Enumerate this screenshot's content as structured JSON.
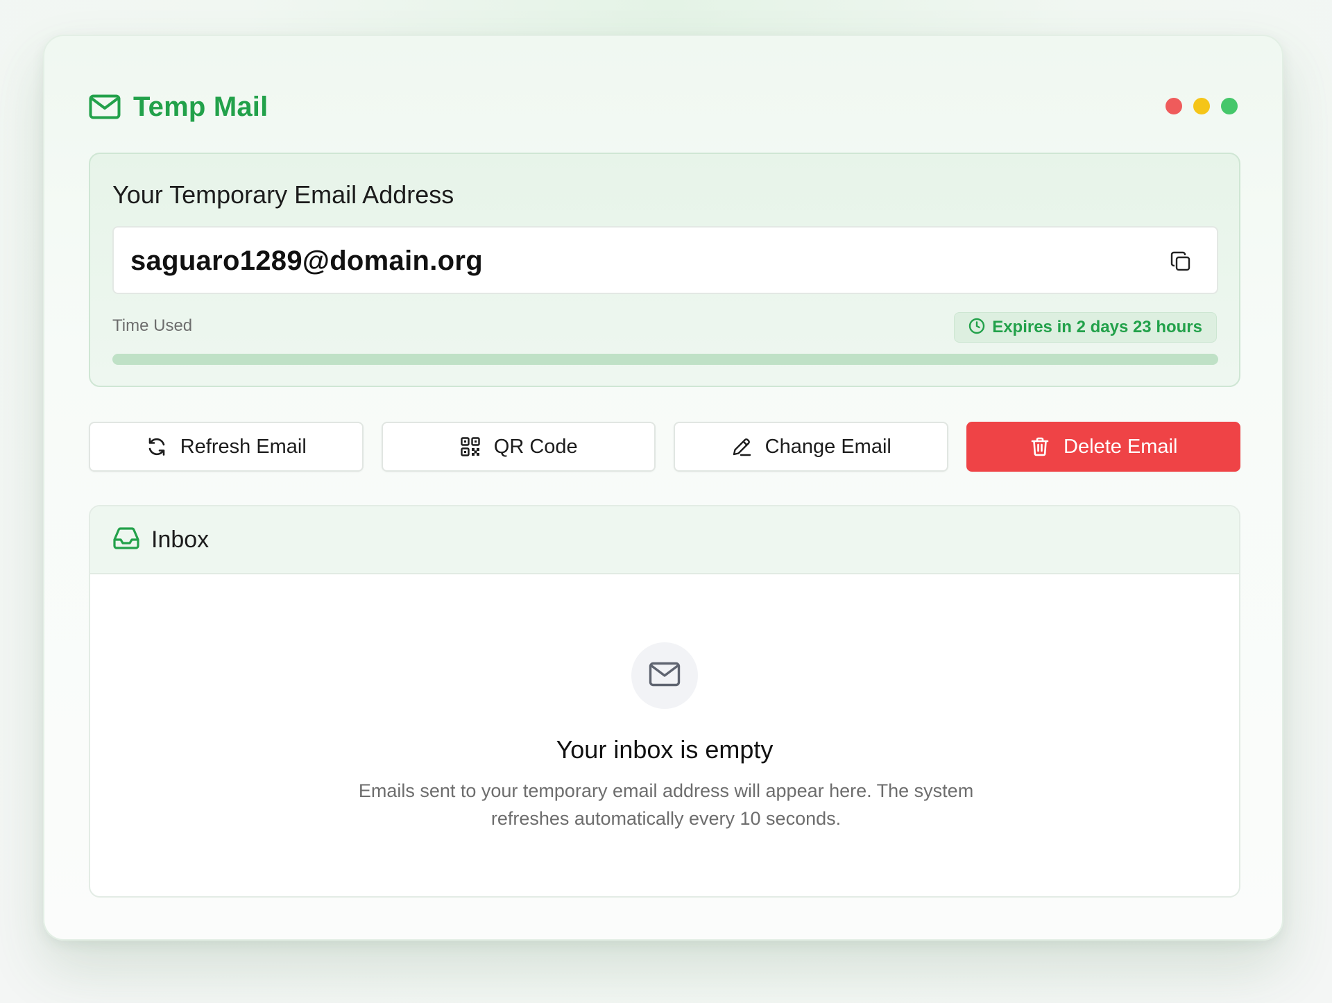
{
  "app": {
    "title": "Temp Mail",
    "accent_color": "#22a14a",
    "window_controls": [
      {
        "name": "close",
        "color": "#ef5b5b"
      },
      {
        "name": "minimize",
        "color": "#f5c518"
      },
      {
        "name": "maximize",
        "color": "#45c76a"
      }
    ]
  },
  "email_card": {
    "title": "Your Temporary Email Address",
    "address": "saguaro1289@domain.org",
    "copy_icon": "copy-icon",
    "time_used_label": "Time Used",
    "expires_text": "Expires in 2 days 23 hours",
    "expires_icon": "clock-icon",
    "time_used_fraction": 1.0
  },
  "actions": {
    "refresh": {
      "label": "Refresh Email",
      "icon": "refresh-icon"
    },
    "qr": {
      "label": "QR Code",
      "icon": "qr-code-icon"
    },
    "change": {
      "label": "Change Email",
      "icon": "pencil-icon"
    },
    "delete": {
      "label": "Delete Email",
      "icon": "trash-icon",
      "color": "#ef4346"
    }
  },
  "inbox": {
    "title": "Inbox",
    "icon": "inbox-icon",
    "empty_icon": "mail-icon",
    "empty_title": "Your inbox is empty",
    "empty_description": "Emails sent to your temporary email address will appear here. The system refreshes automatically every 10 seconds."
  }
}
